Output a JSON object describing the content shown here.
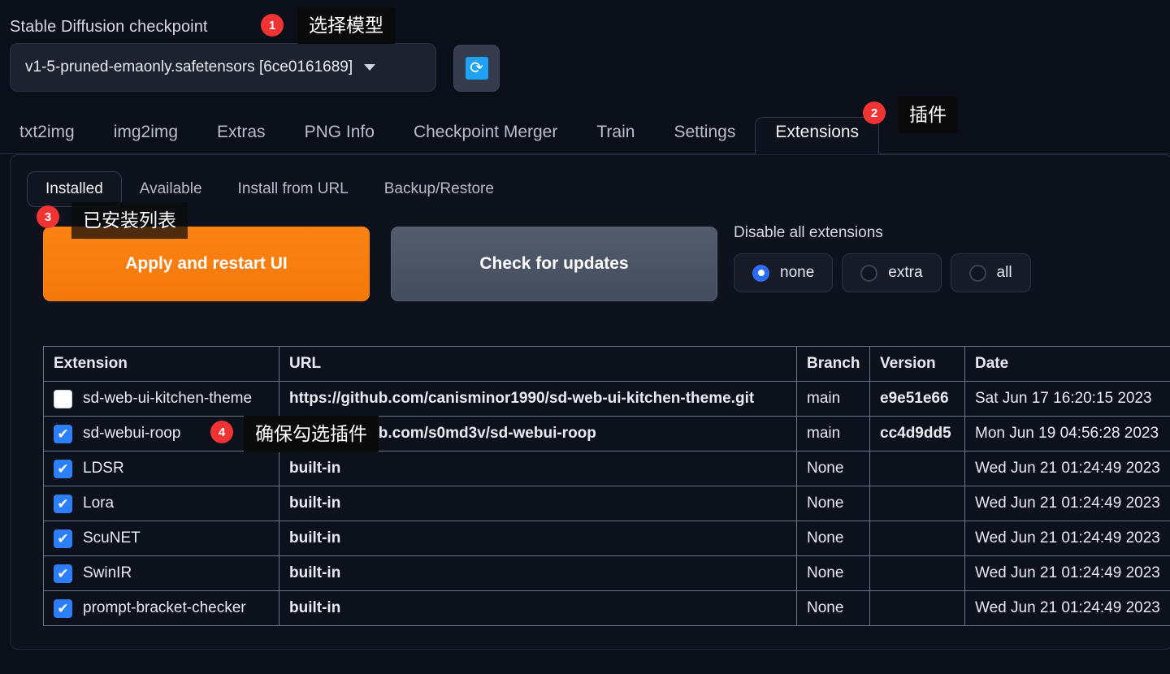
{
  "checkpoint": {
    "label": "Stable Diffusion checkpoint",
    "value": "v1-5-pruned-emaonly.safetensors [6ce0161689]",
    "refresh_icon": "refresh-icon",
    "caret_icon": "chevron-down-icon"
  },
  "main_tabs": [
    {
      "label": "txt2img",
      "selected": false
    },
    {
      "label": "img2img",
      "selected": false
    },
    {
      "label": "Extras",
      "selected": false
    },
    {
      "label": "PNG Info",
      "selected": false
    },
    {
      "label": "Checkpoint Merger",
      "selected": false
    },
    {
      "label": "Train",
      "selected": false
    },
    {
      "label": "Settings",
      "selected": false
    },
    {
      "label": "Extensions",
      "selected": true
    }
  ],
  "sub_tabs": [
    {
      "label": "Installed",
      "selected": true
    },
    {
      "label": "Available",
      "selected": false
    },
    {
      "label": "Install from URL",
      "selected": false
    },
    {
      "label": "Backup/Restore",
      "selected": false
    }
  ],
  "actions": {
    "apply_label": "Apply and restart UI",
    "check_updates_label": "Check for updates",
    "disable_label": "Disable all extensions",
    "radios": [
      {
        "label": "none",
        "selected": true
      },
      {
        "label": "extra",
        "selected": false
      },
      {
        "label": "all",
        "selected": false
      }
    ]
  },
  "table": {
    "headers": [
      "Extension",
      "URL",
      "Branch",
      "Version",
      "Date"
    ],
    "rows": [
      {
        "checked": false,
        "extension": "sd-web-ui-kitchen-theme",
        "url": "https://github.com/canisminor1990/sd-web-ui-kitchen-theme.git",
        "branch": "main",
        "version": "e9e51e66",
        "date": "Sat Jun 17 16:20:15 2023"
      },
      {
        "checked": true,
        "extension": "sd-webui-roop",
        "url": "https://github.com/s0md3v/sd-webui-roop",
        "branch": "main",
        "version": "cc4d9dd5",
        "date": "Mon Jun 19 04:56:28 2023"
      },
      {
        "checked": true,
        "extension": "LDSR",
        "url": "built-in",
        "branch": "None",
        "version": "",
        "date": "Wed Jun 21 01:24:49 2023"
      },
      {
        "checked": true,
        "extension": "Lora",
        "url": "built-in",
        "branch": "None",
        "version": "",
        "date": "Wed Jun 21 01:24:49 2023"
      },
      {
        "checked": true,
        "extension": "ScuNET",
        "url": "built-in",
        "branch": "None",
        "version": "",
        "date": "Wed Jun 21 01:24:49 2023"
      },
      {
        "checked": true,
        "extension": "SwinIR",
        "url": "built-in",
        "branch": "None",
        "version": "",
        "date": "Wed Jun 21 01:24:49 2023"
      },
      {
        "checked": true,
        "extension": "prompt-bracket-checker",
        "url": "built-in",
        "branch": "None",
        "version": "",
        "date": "Wed Jun 21 01:24:49 2023"
      }
    ]
  },
  "annotations": [
    {
      "number": "1",
      "text": "选择模型"
    },
    {
      "number": "2",
      "text": "插件"
    },
    {
      "number": "3",
      "text": "已安装列表"
    },
    {
      "number": "4",
      "text": "确保勾选插件"
    }
  ],
  "colors": {
    "accent_orange": "#f4780a",
    "accent_blue": "#2d7ff9",
    "badge_red": "#f03434",
    "page_bg": "#0b0f19"
  }
}
